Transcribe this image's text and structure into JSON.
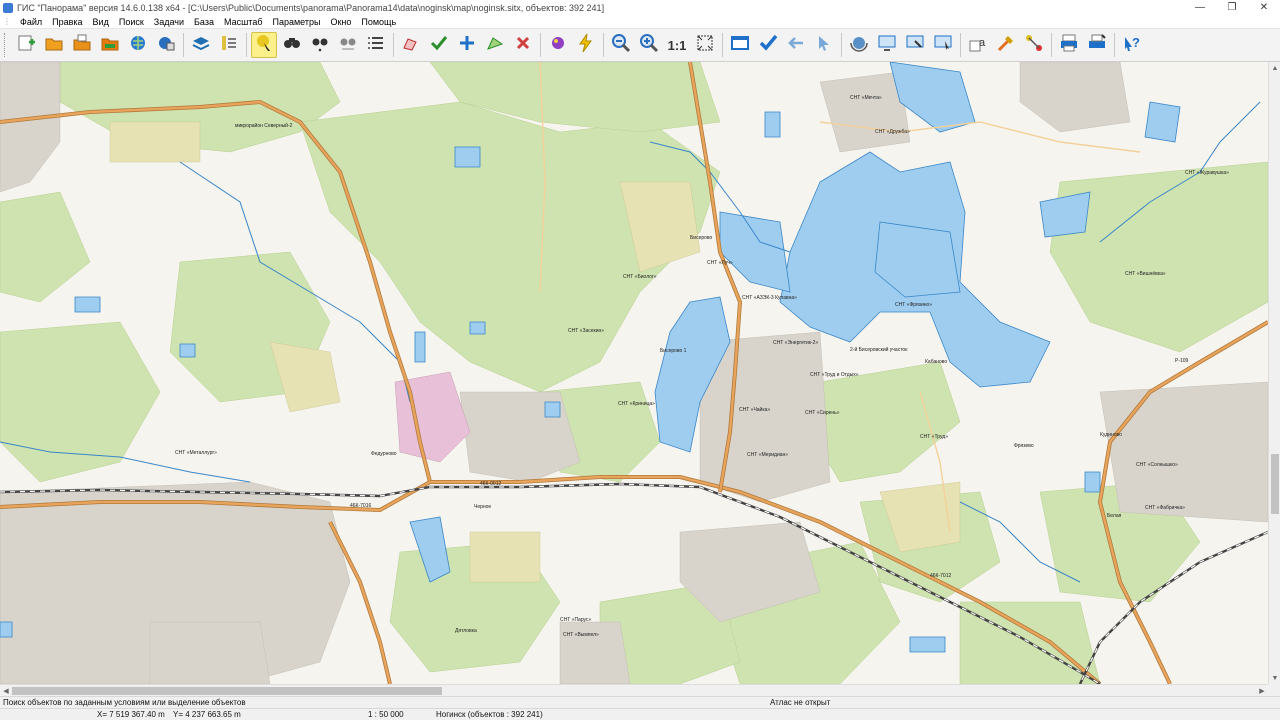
{
  "window": {
    "title": "ГИС \"Панорама\" версия 14.6.0.138 x64 - [C:\\Users\\Public\\Documents\\panorama\\Panorama14\\data\\noginsk\\map\\noginsk.sitx, объектов: 392 241]",
    "minimize_glyph": "—",
    "maximize_glyph": "❐",
    "close_glyph": "✕"
  },
  "menu": {
    "items": [
      "Файл",
      "Правка",
      "Вид",
      "Поиск",
      "Задачи",
      "База",
      "Масштаб",
      "Параметры",
      "Окно",
      "Помощь"
    ]
  },
  "toolbar": {
    "scale_button_label": "1:1",
    "buttons": [
      {
        "icon": "create-map-icon",
        "color": "#2e9c3a"
      },
      {
        "icon": "open-folder-icon",
        "color": "#f0a020"
      },
      {
        "icon": "open-folder-stack-icon",
        "color": "#e89018"
      },
      {
        "icon": "open-osm-icon",
        "color": "#e87a10"
      },
      {
        "icon": "globe-icon",
        "color": "#2a7bd0"
      },
      {
        "icon": "globe-layers-icon",
        "color": "#2a6ec0"
      },
      {
        "icon": "layers-icon",
        "color": "#1f6fb2"
      },
      {
        "icon": "map-legend-icon",
        "color": "#555555"
      },
      {
        "icon": "select-object-icon",
        "color": "#e8c820"
      },
      {
        "icon": "binoculars-icon",
        "color": "#333333"
      },
      {
        "icon": "binoculars-next-icon",
        "color": "#333333"
      },
      {
        "icon": "binoculars-all-icon",
        "color": "#888888"
      },
      {
        "icon": "list-icon",
        "color": "#444444"
      },
      {
        "icon": "edit-object-icon",
        "color": "#c03030"
      },
      {
        "icon": "check-object-icon",
        "color": "#2a8f2a"
      },
      {
        "icon": "add-point-icon",
        "color": "#1e70c8"
      },
      {
        "icon": "edit-vertex-icon",
        "color": "#2a8f2a"
      },
      {
        "icon": "delete-object-icon",
        "color": "#d04040"
      },
      {
        "icon": "paint-icon",
        "color": "#9040c0"
      },
      {
        "icon": "lightning-icon",
        "color": "#f0c000"
      },
      {
        "icon": "zoom-out-icon",
        "color": "#2a6ec0"
      },
      {
        "icon": "zoom-in-icon",
        "color": "#2a6ec0"
      },
      {
        "icon": "zoom-1to1-icon",
        "color": "#333333"
      },
      {
        "icon": "fit-window-icon",
        "color": "#333333"
      },
      {
        "icon": "window-icon",
        "color": "#1e70c8"
      },
      {
        "icon": "checkmark-icon",
        "color": "#1e70c8"
      },
      {
        "icon": "back-arrow-icon",
        "color": "#7aa8d8"
      },
      {
        "icon": "cursor-icon",
        "color": "#7aa8d8"
      },
      {
        "icon": "rotate-globe-icon",
        "color": "#5a90c8"
      },
      {
        "icon": "screen-map-icon",
        "color": "#1e70c8"
      },
      {
        "icon": "screen-select-icon",
        "color": "#1e70c8"
      },
      {
        "icon": "screen-pointer-icon",
        "color": "#1e70c8"
      },
      {
        "icon": "text-label-icon",
        "color": "#333333"
      },
      {
        "icon": "tools-icon",
        "color": "#e07020"
      },
      {
        "icon": "route-icon",
        "color": "#e0c020"
      },
      {
        "icon": "printer-icon",
        "color": "#1e70c8"
      },
      {
        "icon": "print-preview-icon",
        "color": "#1e70c8"
      },
      {
        "icon": "help-icon",
        "color": "#1e70c8"
      }
    ]
  },
  "map": {
    "labels": [
      {
        "text": "СНТ «Вишнёвка»"
      },
      {
        "text": "микрорайон Северный-2"
      },
      {
        "text": "СНТ «Засекин»"
      },
      {
        "text": "СНТ «Биолог»"
      },
      {
        "text": "СНТ «Журавушка»"
      },
      {
        "text": "СНТ «АЗЭК-3 Купавна»"
      },
      {
        "text": "СНТ «Энергетик-2»"
      },
      {
        "text": "СНТ «Фрязино»"
      },
      {
        "text": "СНТ «Луч»"
      },
      {
        "text": "СНТ «Металлург»"
      },
      {
        "text": "СНТ «Криница»"
      },
      {
        "text": "СНТ «Чайка»"
      },
      {
        "text": "СНТ «Меридиан»"
      },
      {
        "text": "СНТ «Сирень»"
      },
      {
        "text": "СНТ «Труд и Отдых»"
      },
      {
        "text": "СНТ «Труд»"
      },
      {
        "text": "СНТ «Солнышко»"
      },
      {
        "text": "СНТ «Мечта»"
      },
      {
        "text": "СНТ «Фабричка»"
      },
      {
        "text": "СНТ «Парус»"
      },
      {
        "text": "СНТ «Вымпел»"
      },
      {
        "text": "Бисерово"
      },
      {
        "text": "Фрязево"
      },
      {
        "text": "Кудиново"
      },
      {
        "text": "Белая"
      },
      {
        "text": "Дятловка"
      },
      {
        "text": "Черное"
      },
      {
        "text": "СНТ «Дружба»"
      },
      {
        "text": "Федурново"
      },
      {
        "text": "46К-0012"
      },
      {
        "text": "46К-7016"
      },
      {
        "text": "46К-7012"
      },
      {
        "text": "Р-109"
      },
      {
        "text": "2-й Бисеровский участок"
      },
      {
        "text": "Кабаново"
      },
      {
        "text": "Бисерово 1"
      }
    ]
  },
  "status": {
    "hint": "Поиск объектов по заданным условиям или выделение объектов",
    "atlas": "Атлас не открыт",
    "x_coord": "X= 7 519 367.40 m",
    "y_coord": "Y= 4 237 663.65 m",
    "scale": "1 : 50 000",
    "map_info": "Ногинск  (объектов : 392 241)"
  },
  "colors": {
    "map_background": "#f6f4ee",
    "forest": "#cfe3b0",
    "water": "#9fcdef",
    "water_stroke": "#3a87c8",
    "road_major": "#e9a45c",
    "road_edge": "#b07a3c",
    "settlement": "#d8d4cc",
    "industrial": "#e8c0d8",
    "railway": "#444444"
  }
}
